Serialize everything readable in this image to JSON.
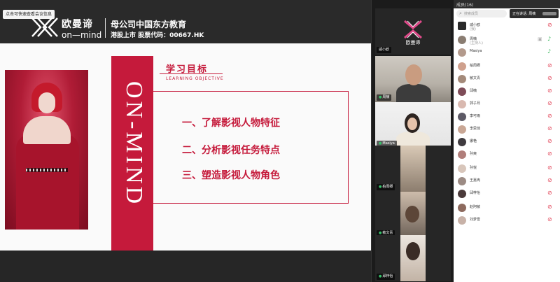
{
  "tip": "点击可快速查看会议信息",
  "brand": {
    "logo_cn": "欧曼谛",
    "logo_en": "on—mind",
    "company": "母公司中国东方教育",
    "stock": "港股上市 股票代码：00667.HK"
  },
  "slide": {
    "vertical_text": "ON-MIND",
    "title": "学习目标",
    "subtitle": "LEARNING  OBJECTIVE",
    "objectives": [
      "一、了解影视人物特征",
      "二、分析影视任务特点",
      "三、塑造影视人物角色"
    ],
    "accent_color": "#c51a3b"
  },
  "videos": [
    {
      "name": "戚小欧",
      "mic": false,
      "logo_text": "欧曼谛"
    },
    {
      "name": "周楠",
      "mic": true
    },
    {
      "name": "Masiya",
      "mic": true
    },
    {
      "name": "柏周卿",
      "mic": true
    },
    {
      "name": "敏文青",
      "mic": true
    },
    {
      "name": "邱梓怡",
      "mic": true
    }
  ],
  "panel": {
    "title": "成员(16)",
    "search_placeholder": "搜索成员",
    "speaking": "正在讲话: 周楠",
    "participants": [
      {
        "name": "戚小欧",
        "sub": "(我)",
        "icon": "logo-avatar",
        "mic": "muted"
      },
      {
        "name": "周楠",
        "sub": "(主持人)",
        "icon": "avatar",
        "mic": "on",
        "camera": true
      },
      {
        "name": "Masiya",
        "sub": "",
        "icon": "avatar",
        "mic": "on"
      },
      {
        "name": "柏周卿",
        "sub": "",
        "icon": "avatar",
        "mic": "muted"
      },
      {
        "name": "敏文青",
        "sub": "",
        "icon": "avatar",
        "mic": "muted"
      },
      {
        "name": "邱楠",
        "sub": "",
        "icon": "avatar",
        "mic": "muted"
      },
      {
        "name": "郭子月",
        "sub": "",
        "icon": "avatar",
        "mic": "muted"
      },
      {
        "name": "李可雨",
        "sub": "",
        "icon": "avatar",
        "mic": "muted"
      },
      {
        "name": "李思佳",
        "sub": "",
        "icon": "avatar",
        "mic": "muted"
      },
      {
        "name": "娜艳",
        "sub": "",
        "icon": "avatar",
        "mic": "muted"
      },
      {
        "name": "孙爽",
        "sub": "",
        "icon": "avatar",
        "mic": "muted"
      },
      {
        "name": "孙悦",
        "sub": "",
        "icon": "avatar",
        "mic": "muted"
      },
      {
        "name": "王嘉冉",
        "sub": "",
        "icon": "avatar",
        "mic": "muted"
      },
      {
        "name": "邱梓怡",
        "sub": "",
        "icon": "avatar",
        "mic": "muted"
      },
      {
        "name": "赵阿敏",
        "sub": "",
        "icon": "avatar",
        "mic": "muted"
      },
      {
        "name": "刘梦雪",
        "sub": "",
        "icon": "avatar",
        "mic": "muted"
      }
    ]
  }
}
